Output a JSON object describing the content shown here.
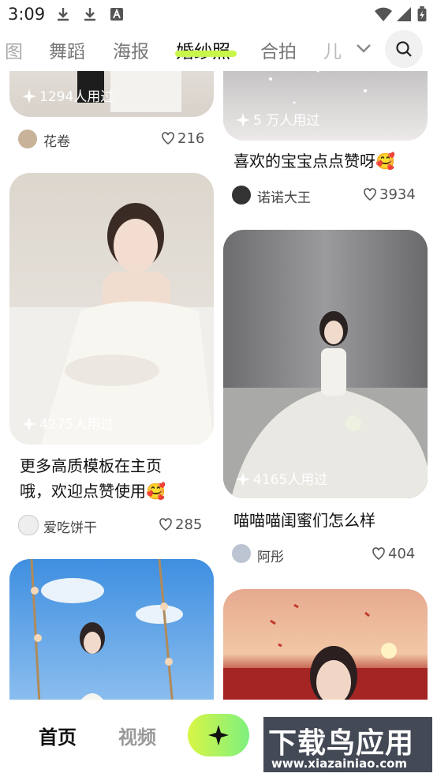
{
  "status_bar": {
    "time": "3:09"
  },
  "top_tabs": {
    "items": [
      "图",
      "舞蹈",
      "海报",
      "婚纱照",
      "合拍",
      "儿"
    ],
    "active_index": 3,
    "active_color": "#c9f64a"
  },
  "feed": {
    "cards": [
      {
        "used": "1294人用过",
        "title": "",
        "author": "花卷",
        "likes": "216"
      },
      {
        "used": "5 万人用过",
        "title": "喜欢的宝宝点点赞呀🥰",
        "author": "诺诺大王",
        "likes": "3934"
      },
      {
        "used": "4275人用过",
        "title_line1": "更多高质模板在主页",
        "title_line2": "哦，欢迎点赞使用🥰",
        "author": "爱吃饼干",
        "likes": "285"
      },
      {
        "used": "4165人用过",
        "title": "喵喵喵闺蜜们怎么样",
        "author": "阿彤",
        "likes": "404"
      }
    ]
  },
  "bottom_nav": {
    "home": "首页",
    "video": "视频",
    "create_icon": "sparkle-icon"
  },
  "watermark": {
    "title": "下载鸟应用",
    "url": "www.xiazainiao.com"
  }
}
